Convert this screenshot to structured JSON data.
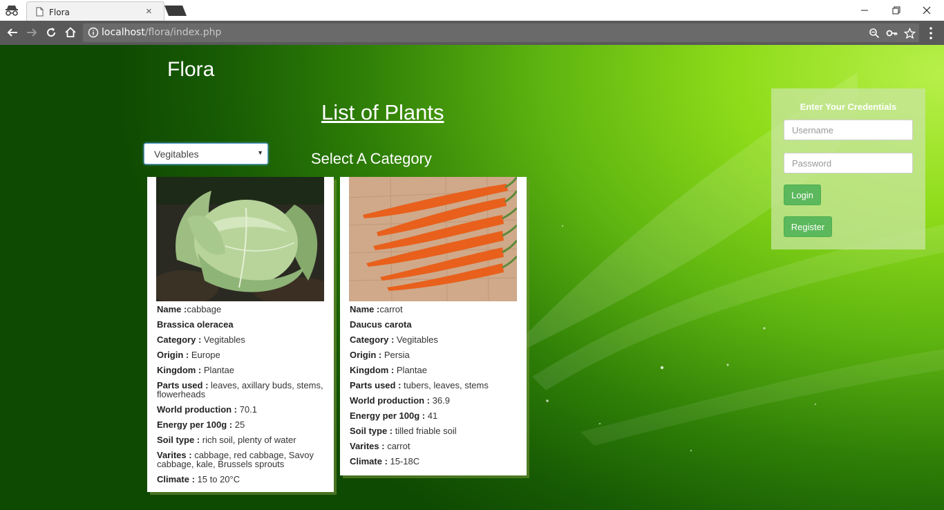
{
  "browser": {
    "tab_title": "Flora",
    "tab_close": "×",
    "url_host": "localhost",
    "url_path": "/flora/index.php"
  },
  "page": {
    "site_title": "Flora",
    "list_heading": "List of Plants",
    "category_select": {
      "selected": "Vegitables"
    },
    "select_label": "Select A Category"
  },
  "plants": [
    {
      "rows": [
        {
          "label": "Name :",
          "value": "cabbage"
        },
        {
          "label": "Brassica oleracea",
          "value": ""
        },
        {
          "label": "Category : ",
          "value": "Vegitables"
        },
        {
          "label": "Origin : ",
          "value": "Europe"
        },
        {
          "label": "Kingdom : ",
          "value": "Plantae"
        },
        {
          "label": "Parts used : ",
          "value": "leaves, axillary buds, stems, flowerheads"
        },
        {
          "label": "World production : ",
          "value": "70.1"
        },
        {
          "label": "Energy per 100g : ",
          "value": "25"
        },
        {
          "label": "Soil type : ",
          "value": "rich soil, plenty of water"
        },
        {
          "label": "Varites : ",
          "value": "cabbage, red cabbage, Savoy cabbage, kale, Brussels sprouts"
        },
        {
          "label": "Climate : ",
          "value": "15 to 20°C"
        }
      ]
    },
    {
      "rows": [
        {
          "label": "Name :",
          "value": "carrot"
        },
        {
          "label": "Daucus carota",
          "value": ""
        },
        {
          "label": "Category : ",
          "value": "Vegitables"
        },
        {
          "label": "Origin : ",
          "value": "Persia"
        },
        {
          "label": "Kingdom : ",
          "value": "Plantae"
        },
        {
          "label": "Parts used : ",
          "value": "tubers, leaves, stems"
        },
        {
          "label": "World production : ",
          "value": "36.9"
        },
        {
          "label": "Energy per 100g : ",
          "value": "41"
        },
        {
          "label": "Soil type : ",
          "value": "tilled friable soil"
        },
        {
          "label": "Varites : ",
          "value": "carrot"
        },
        {
          "label": "Climate : ",
          "value": "15-18C"
        }
      ]
    }
  ],
  "login": {
    "title": "Enter Your Credentials",
    "username_placeholder": "Username",
    "password_placeholder": "Password",
    "login_label": "Login",
    "register_label": "Register"
  }
}
